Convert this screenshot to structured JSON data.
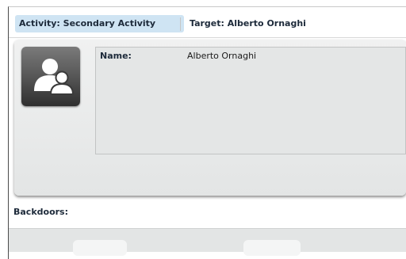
{
  "tabs": {
    "activity_label": "Activity: Secondary Activity",
    "target_label": "Target: Alberto Ornaghi"
  },
  "target_info": {
    "name_label": "Name:",
    "name_value": "Alberto Ornaghi",
    "avatar_icon": "user-group-icon"
  },
  "backdoors": {
    "label": "Backdoors:"
  },
  "colors": {
    "active_tab_bg": "#cfe4f3",
    "panel_bg": "#e4e6e6"
  }
}
